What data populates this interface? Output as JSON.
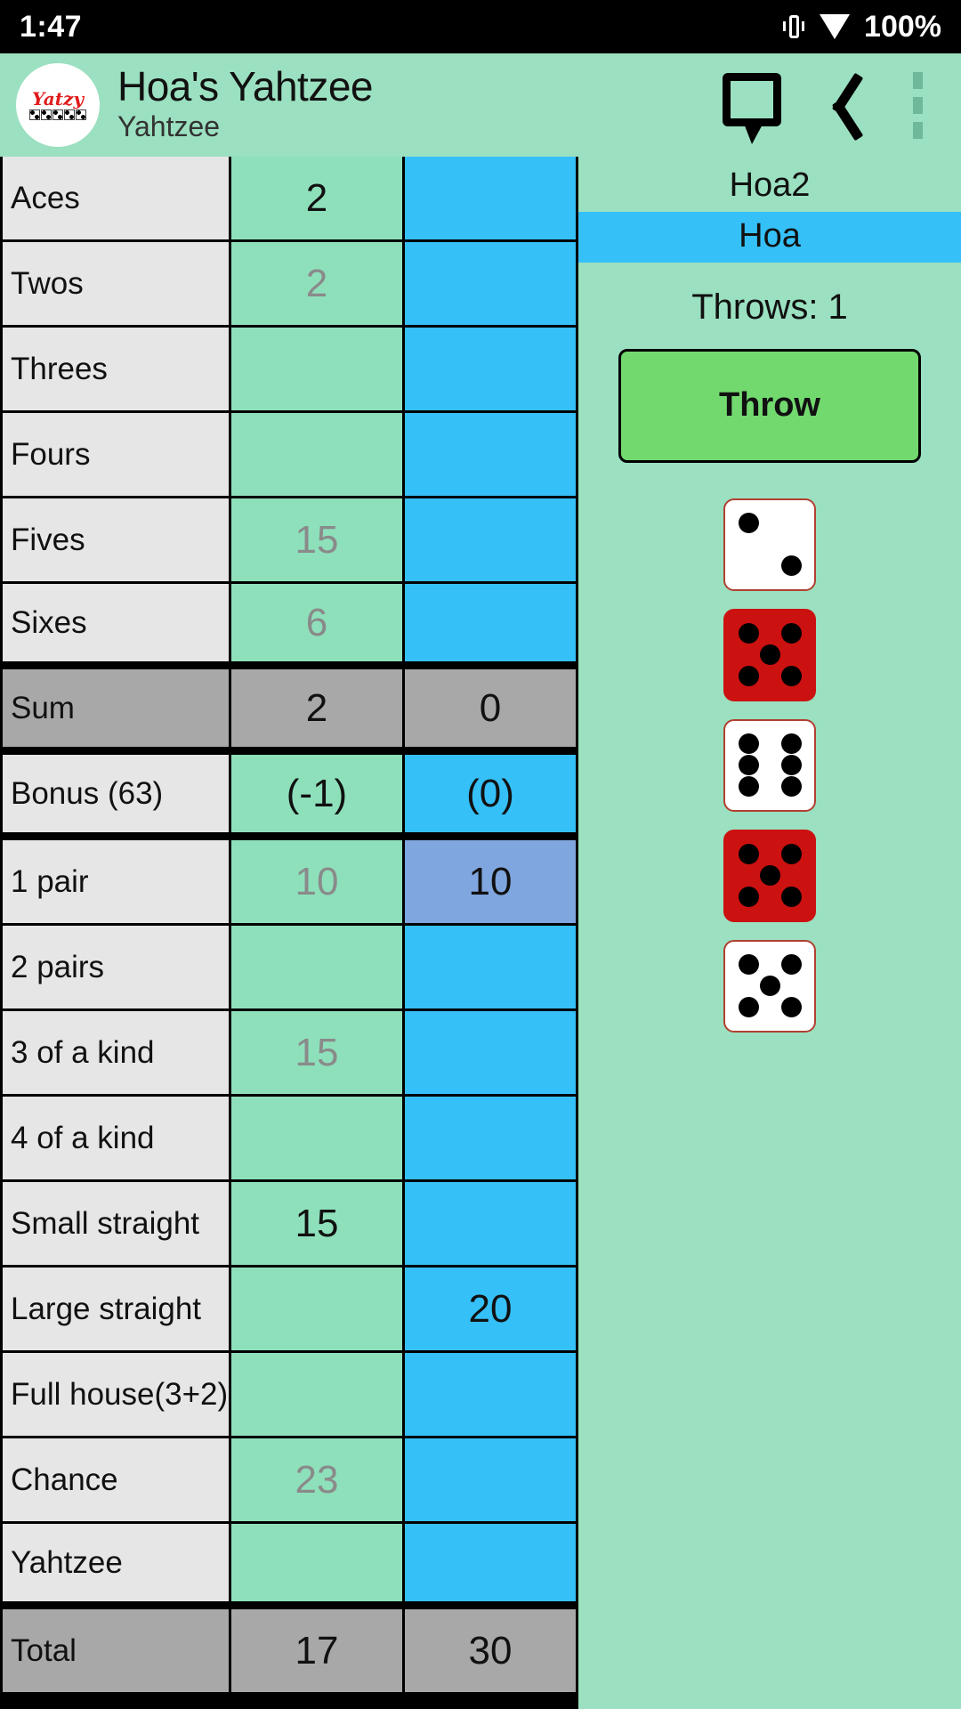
{
  "status_bar": {
    "time": "1:47",
    "battery": "100%",
    "vibrate_icon": "vibrate-icon",
    "wifi_icon": "wifi-icon"
  },
  "app_bar": {
    "logo_word": "Yatzy",
    "title": "Hoa's Yahtzee",
    "subtitle": "Yahtzee",
    "chat_icon": "chat-bubble-icon",
    "back_icon": "back-chevron-icon",
    "menu_icon": "overflow-menu-icon"
  },
  "side_panel": {
    "other_player": "Hoa2",
    "current_player": "Hoa",
    "throws": "Throws: 1",
    "throw_button": "Throw",
    "accent_blue": "#35C0F8",
    "accent_green": "#72D96F",
    "dice": [
      {
        "value": 2,
        "held": false
      },
      {
        "value": 5,
        "held": true
      },
      {
        "value": 6,
        "held": false
      },
      {
        "value": 5,
        "held": true
      },
      {
        "value": 5,
        "held": false
      }
    ]
  },
  "score_table": {
    "rows": [
      {
        "name": "Aces",
        "p1": "2",
        "p1_state": "firm",
        "p2": "",
        "p2_state": "empty",
        "kind": "normal"
      },
      {
        "name": "Twos",
        "p1": "2",
        "p1_state": "hint",
        "p2": "",
        "p2_state": "empty",
        "kind": "normal"
      },
      {
        "name": "Threes",
        "p1": "",
        "p1_state": "empty",
        "p2": "",
        "p2_state": "empty",
        "kind": "normal"
      },
      {
        "name": "Fours",
        "p1": "",
        "p1_state": "empty",
        "p2": "",
        "p2_state": "empty",
        "kind": "normal"
      },
      {
        "name": "Fives",
        "p1": "15",
        "p1_state": "hint",
        "p2": "",
        "p2_state": "empty",
        "kind": "normal"
      },
      {
        "name": "Sixes",
        "p1": "6",
        "p1_state": "hint",
        "p2": "",
        "p2_state": "empty",
        "kind": "sep"
      },
      {
        "name": "Sum",
        "p1": "2",
        "p1_state": "firm",
        "p2": "0",
        "p2_state": "firm",
        "kind": "sum"
      },
      {
        "name": "Bonus (63)",
        "p1": "(-1)",
        "p1_state": "firm",
        "p2": "(0)",
        "p2_state": "firm",
        "kind": "sep"
      },
      {
        "name": "1 pair",
        "p1": "10",
        "p1_state": "hint",
        "p2": "10",
        "p2_state": "firm",
        "kind": "selected"
      },
      {
        "name": "2 pairs",
        "p1": "",
        "p1_state": "empty",
        "p2": "",
        "p2_state": "empty",
        "kind": "normal"
      },
      {
        "name": "3 of a kind",
        "p1": "15",
        "p1_state": "hint",
        "p2": "",
        "p2_state": "empty",
        "kind": "normal"
      },
      {
        "name": "4 of a kind",
        "p1": "",
        "p1_state": "empty",
        "p2": "",
        "p2_state": "empty",
        "kind": "normal"
      },
      {
        "name": "Small straight",
        "p1": "15",
        "p1_state": "firm",
        "p2": "",
        "p2_state": "empty",
        "kind": "normal"
      },
      {
        "name": "Large straight",
        "p1": "",
        "p1_state": "empty",
        "p2": "20",
        "p2_state": "firm",
        "kind": "normal"
      },
      {
        "name": "Full house(3+2)",
        "p1": "",
        "p1_state": "empty",
        "p2": "",
        "p2_state": "empty",
        "kind": "normal"
      },
      {
        "name": "Chance",
        "p1": "23",
        "p1_state": "hint",
        "p2": "",
        "p2_state": "empty",
        "kind": "normal"
      },
      {
        "name": "Yahtzee",
        "p1": "",
        "p1_state": "empty",
        "p2": "",
        "p2_state": "empty",
        "kind": "sep"
      },
      {
        "name": "Total",
        "p1": "17",
        "p1_state": "firm",
        "p2": "30",
        "p2_state": "firm",
        "kind": "total"
      }
    ]
  }
}
